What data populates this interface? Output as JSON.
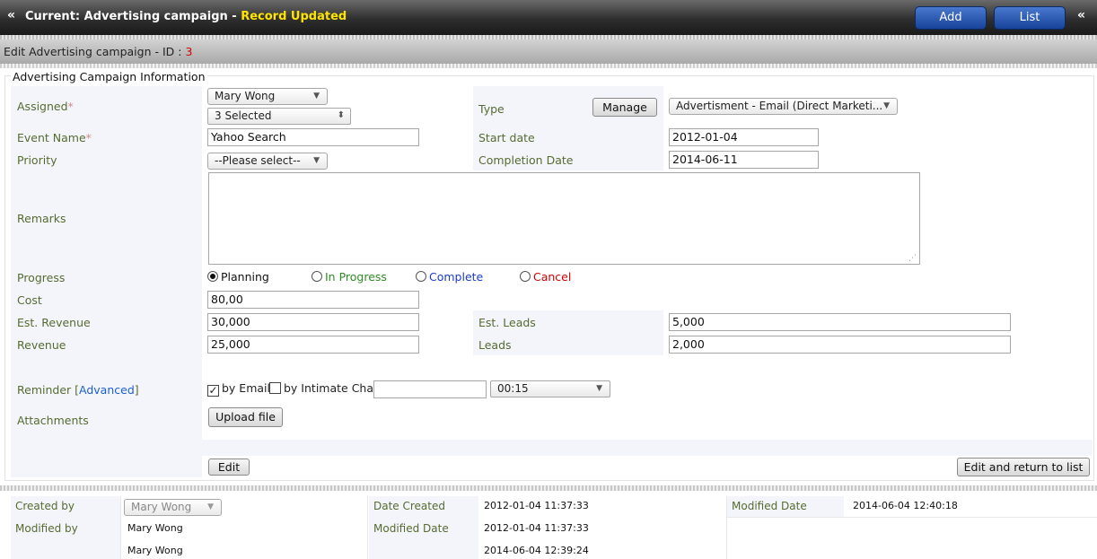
{
  "header": {
    "title_prefix": "Current: Advertising campaign - ",
    "title_status": "Record Updated",
    "add_label": "Add",
    "list_label": "List",
    "collapse_glyph": "«"
  },
  "subheader": {
    "text": "Edit Advertising campaign - ID : ",
    "record_id": "3"
  },
  "section": {
    "legend": "Advertising Campaign Information"
  },
  "form": {
    "assigned": {
      "label": "Assigned",
      "user": "Mary Wong",
      "multi": "3 Selected"
    },
    "type": {
      "label": "Type",
      "manage_label": "Manage",
      "value": "Advertisment - Email (Direct Marketi..."
    },
    "event_name": {
      "label": "Event Name",
      "value": "Yahoo Search"
    },
    "start_date": {
      "label": "Start date",
      "value": "2012-01-04"
    },
    "priority": {
      "label": "Priority",
      "value": "--Please select--"
    },
    "completion_date": {
      "label": "Completion Date",
      "value": "2014-06-11"
    },
    "remarks": {
      "label": "Remarks",
      "value": ""
    },
    "progress": {
      "label": "Progress",
      "options": [
        {
          "label": "Planning",
          "color": "#111111",
          "checked": true
        },
        {
          "label": "In Progress",
          "color": "#2e8b22",
          "checked": false
        },
        {
          "label": "Complete",
          "color": "#1a3acc",
          "checked": false
        },
        {
          "label": "Cancel",
          "color": "#d00000",
          "checked": false
        }
      ]
    },
    "cost": {
      "label": "Cost",
      "value": "80,00"
    },
    "est_revenue": {
      "label": "Est. Revenue",
      "value": "30,000"
    },
    "est_leads": {
      "label": "Est. Leads",
      "value": "5,000"
    },
    "revenue": {
      "label": "Revenue",
      "value": "25,000"
    },
    "leads": {
      "label": "Leads",
      "value": "2,000"
    },
    "reminder": {
      "label": "Reminder",
      "advanced_link": "Advanced",
      "by_email_label": "by Email",
      "by_email_checked": true,
      "by_chat_label": "by Intimate Chat",
      "by_chat_checked": false,
      "text_value": "",
      "time_value": "00:15"
    },
    "attachments": {
      "label": "Attachments",
      "upload_label": "Upload file"
    },
    "edit_label": "Edit",
    "edit_return_label": "Edit and return to list"
  },
  "audit": {
    "created_by_label": "Created by",
    "created_by_value": "Mary Wong",
    "modified_by_label": "Modified by",
    "modified_by_value": "Mary Wong",
    "modified_by_value2": "Mary Wong",
    "date_created_label": "Date Created",
    "date_created_value": "2012-01-04 11:37:33",
    "modified_date_label": "Modified Date",
    "modified_date_value": "2012-01-04 11:37:33",
    "modified_date_value2": "2014-06-04 12:39:24",
    "right_modified_label": "Modified Date",
    "right_modified_value": "2014-06-04 12:40:18"
  },
  "colors": {
    "label_olive": "#556b2f",
    "required_mark": "#d48a8a",
    "status_yellow": "#ffe400",
    "id_red": "#d00000",
    "button_blue": "#17439a"
  }
}
